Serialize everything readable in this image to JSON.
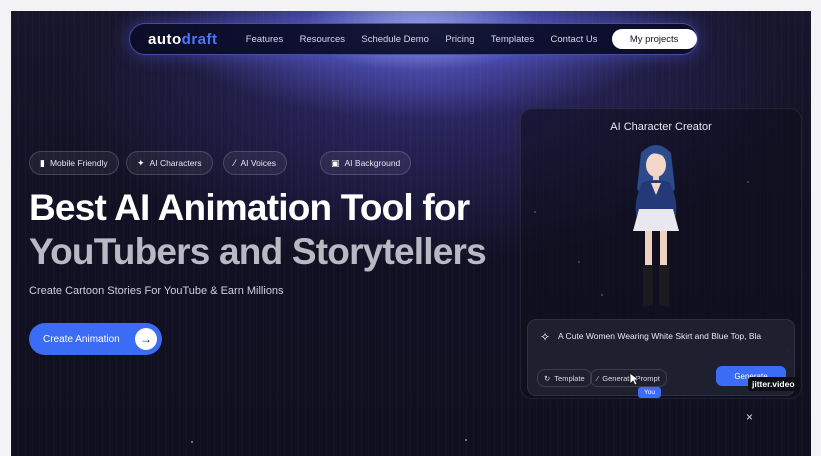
{
  "nav": {
    "logo_left": "auto",
    "logo_right": "draft",
    "links": [
      "Features",
      "Resources",
      "Schedule Demo",
      "Pricing",
      "Templates",
      "Contact Us"
    ],
    "cta": "My projects"
  },
  "chips": [
    {
      "icon": "phone-icon",
      "label": "Mobile Friendly"
    },
    {
      "icon": "sparkle-icon",
      "label": "AI Characters"
    },
    {
      "icon": "magic-wand-icon",
      "label": "AI Voices"
    },
    {
      "icon": "image-icon",
      "label": "AI Background"
    }
  ],
  "hero": {
    "line1": "Best AI Animation Tool for",
    "line2": "YouTubers and Storytellers",
    "subtitle": "Create Cartoon Stories For YouTube & Earn Millions",
    "cta": "Create Animation"
  },
  "demo_card": {
    "title": "AI Character Creator",
    "prompt": "A Cute Women Wearing White Skirt and Blue Top, Bla",
    "template_label": "Template",
    "generate_prompt_label": "Generate Prompt",
    "generate_label": "Generate",
    "cursor_tag": "You",
    "watermark": "jitter.video"
  },
  "colors": {
    "accent": "#3b6cf5",
    "logo_blue": "#4b78ff",
    "background": "#121124"
  }
}
